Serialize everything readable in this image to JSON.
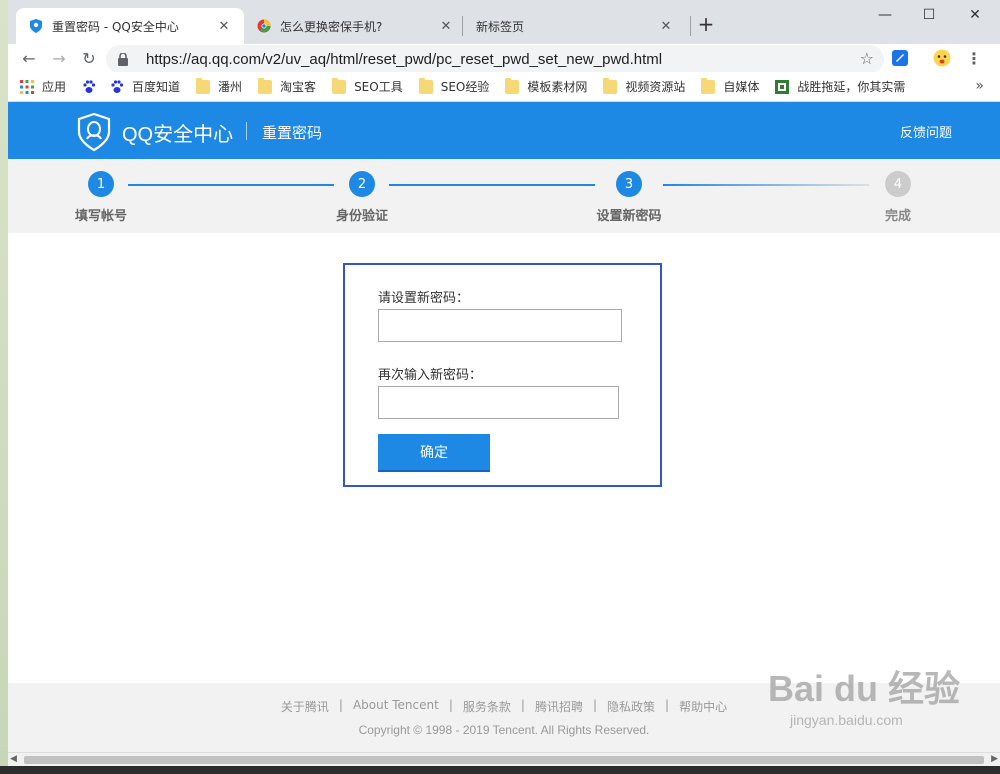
{
  "browser": {
    "tabs": [
      {
        "title": "重置密码 - QQ安全中心",
        "active": true
      },
      {
        "title": "怎么更换密保手机?",
        "active": false
      },
      {
        "title": "新标签页",
        "active": false
      }
    ],
    "url": "https://aq.qq.com/v2/uv_aq/html/reset_pwd/pc_reset_pwd_set_new_pwd.html",
    "bookmarks": [
      "应用",
      "百度知道",
      "潘州",
      "淘宝客",
      "SEO工具",
      "SEO经验",
      "模板素材网",
      "视频资源站",
      "自媒体",
      "战胜拖延，你其实需"
    ],
    "bookmarks_more": "»"
  },
  "header": {
    "brand": "QQ安全中心",
    "subtitle": "重置密码",
    "feedback": "反馈问题",
    "color": "#1e88e5"
  },
  "steps": [
    {
      "num": "1",
      "label": "填写帐号",
      "done": true
    },
    {
      "num": "2",
      "label": "身份验证",
      "done": true
    },
    {
      "num": "3",
      "label": "设置新密码",
      "done": true
    },
    {
      "num": "4",
      "label": "完成",
      "done": false
    }
  ],
  "form": {
    "new_password_label": "请设置新密码：",
    "new_password_value": "",
    "confirm_password_label": "再次输入新密码：",
    "confirm_password_value": "",
    "submit_label": "确定"
  },
  "footer": {
    "links": [
      "关于腾讯",
      "About Tencent",
      "服务条款",
      "腾讯招聘",
      "隐私政策",
      "帮助中心"
    ],
    "separator": "|",
    "copyright": "Copyright © 1998 - 2019 Tencent. All Rights Reserved."
  },
  "watermark": {
    "main": "Bai du 经验",
    "sub": "jingyan.baidu.com"
  }
}
